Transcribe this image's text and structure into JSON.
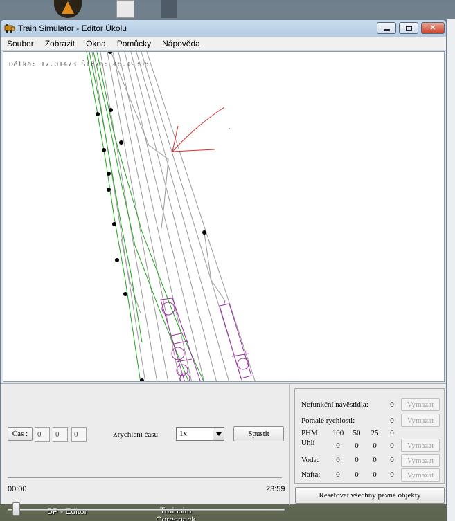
{
  "window": {
    "title": "Train Simulator - Editor Úkolu"
  },
  "menu": [
    "Soubor",
    "Zobrazit",
    "Okna",
    "Pomůcky",
    "Nápověda"
  ],
  "map": {
    "coordinates": "Délka: 17.01473 Šířka: 48.19308"
  },
  "time_controls": {
    "time_button": "Čas :",
    "hours": "0",
    "minutes": "0",
    "seconds": "0",
    "acceleration_label": "Zrychlení času",
    "acceleration_value": "1x",
    "start_button": "Spustit",
    "slider_start": "00:00",
    "slider_end": "23:59",
    "slider_position": 0.0
  },
  "status_panel": {
    "broken_signals_label": "Nefunkční návěstidla:",
    "broken_signals_count": "0",
    "slow_speeds_label": "Pomalé rychlosti:",
    "slow_speeds_count": "0",
    "phm_label": "PHM",
    "columns": [
      "100",
      "50",
      "25",
      "0"
    ],
    "rows": [
      {
        "label": "Uhlí",
        "values": [
          "0",
          "0",
          "0",
          "0"
        ]
      },
      {
        "label": "Voda:",
        "values": [
          "0",
          "0",
          "0",
          "0"
        ]
      },
      {
        "label": "Nafta:",
        "values": [
          "0",
          "0",
          "0",
          "0"
        ]
      }
    ],
    "clear_button": "Vymazat",
    "reset_button": "Resetovat všechny pevné objekty"
  },
  "taskbar": {
    "item1": "BP - Editor",
    "item2_line1": "Trainsim",
    "item2_line2": "Corespack"
  },
  "colors": {
    "track": "#9a9a9a",
    "track_green": "#1fa51f",
    "object_purple": "#9b2fa0",
    "arrow_red": "#e02a2a"
  }
}
